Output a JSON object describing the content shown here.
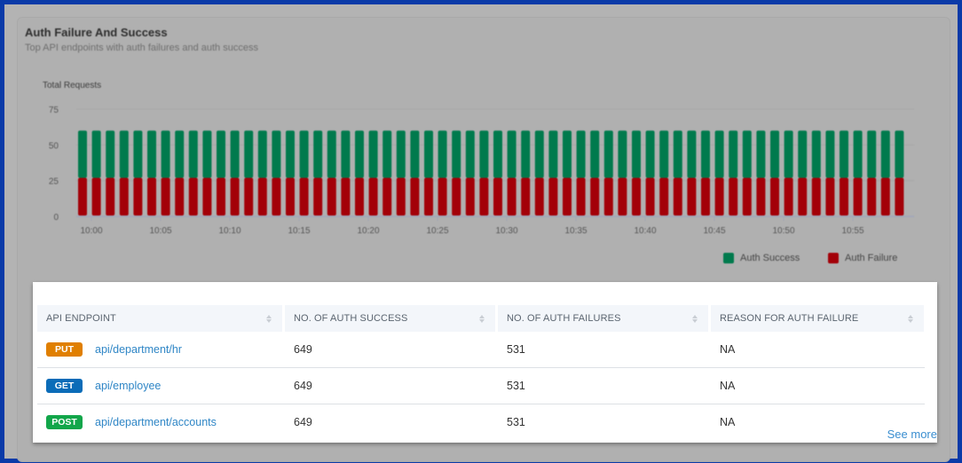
{
  "card": {
    "title": "Auth Failure And Success",
    "subtitle": "Top API endpoints with auth failures and auth success"
  },
  "chart_data": {
    "type": "bar",
    "stacked": true,
    "title": "Auth Failure And Success",
    "ylabel": "Total Requests",
    "xlabel": "",
    "ylim": [
      0,
      75
    ],
    "yticks": [
      "0",
      "25",
      "50",
      "75"
    ],
    "x_tick_labels": [
      "10:00",
      "10:05",
      "10:10",
      "10:15",
      "10:20",
      "10:25",
      "10:30",
      "10:35",
      "10:40",
      "10:45",
      "10:50",
      "10:55"
    ],
    "categories": [
      "10:00",
      "10:01",
      "10:02",
      "10:03",
      "10:04",
      "10:05",
      "10:06",
      "10:07",
      "10:08",
      "10:09",
      "10:10",
      "10:11",
      "10:12",
      "10:13",
      "10:14",
      "10:15",
      "10:16",
      "10:17",
      "10:18",
      "10:19",
      "10:20",
      "10:21",
      "10:22",
      "10:23",
      "10:24",
      "10:25",
      "10:26",
      "10:27",
      "10:28",
      "10:29",
      "10:30",
      "10:31",
      "10:32",
      "10:33",
      "10:34",
      "10:35",
      "10:36",
      "10:37",
      "10:38",
      "10:39",
      "10:40",
      "10:41",
      "10:42",
      "10:43",
      "10:44",
      "10:45",
      "10:46",
      "10:47",
      "10:48",
      "10:49",
      "10:50",
      "10:51",
      "10:52",
      "10:53",
      "10:54",
      "10:55",
      "10:56",
      "10:57",
      "10:58",
      "10:59"
    ],
    "series": [
      {
        "name": "Auth Failure",
        "color": "#a30008",
        "values": [
          27,
          27,
          27,
          27,
          27,
          27,
          27,
          27,
          27,
          27,
          27,
          27,
          27,
          27,
          27,
          27,
          27,
          27,
          27,
          27,
          27,
          27,
          27,
          27,
          27,
          27,
          27,
          27,
          27,
          27,
          27,
          27,
          27,
          27,
          27,
          27,
          27,
          27,
          27,
          27,
          27,
          27,
          27,
          27,
          27,
          27,
          27,
          27,
          27,
          27,
          27,
          27,
          27,
          27,
          27,
          27,
          27,
          27,
          27,
          27
        ]
      },
      {
        "name": "Auth Success",
        "color": "#007a4d",
        "values": [
          33,
          33,
          33,
          33,
          33,
          33,
          33,
          33,
          33,
          33,
          33,
          33,
          33,
          33,
          33,
          33,
          33,
          33,
          33,
          33,
          33,
          33,
          33,
          33,
          33,
          33,
          33,
          33,
          33,
          33,
          33,
          33,
          33,
          33,
          33,
          33,
          33,
          33,
          33,
          33,
          33,
          33,
          33,
          33,
          33,
          33,
          33,
          33,
          33,
          33,
          33,
          33,
          33,
          33,
          33,
          33,
          33,
          33,
          33,
          33
        ]
      }
    ],
    "legend": [
      "Auth Success",
      "Auth Failure"
    ],
    "legend_position": "bottom-right",
    "grid": true
  },
  "table": {
    "columns": [
      {
        "label": "API ENDPOINT"
      },
      {
        "label": "NO. OF AUTH SUCCESS"
      },
      {
        "label": "NO. OF AUTH FAILURES"
      },
      {
        "label": "REASON FOR AUTH FAILURE"
      }
    ],
    "rows": [
      {
        "method": "PUT",
        "method_color": "#e07f00",
        "endpoint": "api/department/hr",
        "success": "649",
        "failures": "531",
        "reason": "NA"
      },
      {
        "method": "GET",
        "method_color": "#0b6cb8",
        "endpoint": "api/employee",
        "success": "649",
        "failures": "531",
        "reason": "NA"
      },
      {
        "method": "POST",
        "method_color": "#12a64a",
        "endpoint": "api/department/accounts",
        "success": "649",
        "failures": "531",
        "reason": "NA"
      }
    ],
    "see_more": "See more"
  }
}
